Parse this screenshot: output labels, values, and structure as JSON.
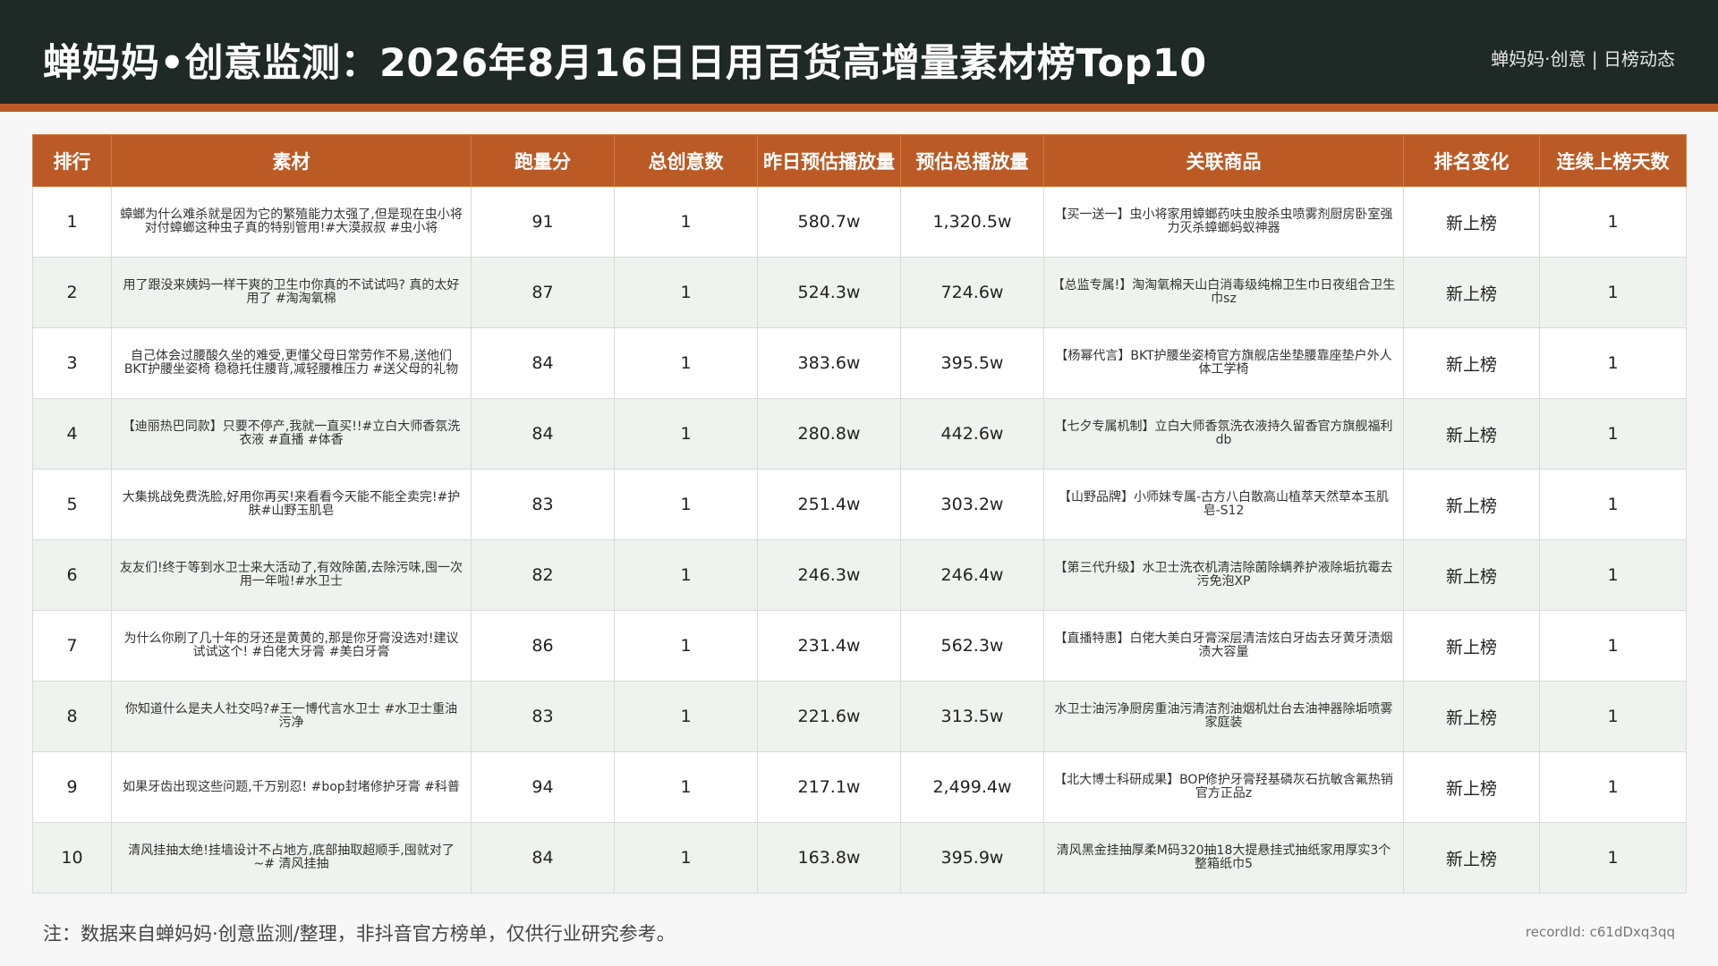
{
  "header": {
    "title": "蝉妈妈•创意监测：2026年8月16日日用百货高增量素材榜Top10",
    "brand_tag": "蝉妈妈·创意 | 日榜动态"
  },
  "colors": {
    "header_bg": "#1f2926",
    "accent": "#bb5a25",
    "alt_row": "#eef3ef"
  },
  "table": {
    "columns": [
      "排行",
      "素材",
      "跑量分",
      "总创意数",
      "昨日预估播放量",
      "预估总播放量",
      "关联商品",
      "排名变化",
      "连续上榜天数"
    ],
    "rows": [
      {
        "rank": "1",
        "material": "蟑螂为什么难杀就是因为它的繁殖能力太强了,但是现在虫小将对付蟑螂这种虫子真的特别管用!#大漠叔叔 #虫小将",
        "score": "91",
        "creatives": "1",
        "yesterday_plays": "580.7w",
        "total_plays": "1,320.5w",
        "product": "【买一送一】虫小将家用蟑螂药呋虫胺杀虫喷雾剂厨房卧室强力灭杀蟑螂蚂蚁神器",
        "rank_change": "新上榜",
        "days": "1"
      },
      {
        "rank": "2",
        "material": "用了跟没来姨妈一样干爽的卫生巾你真的不试试吗? 真的太好用了 #淘淘氧棉",
        "score": "87",
        "creatives": "1",
        "yesterday_plays": "524.3w",
        "total_plays": "724.6w",
        "product": "【总监专属!】淘淘氧棉天山白消毒级纯棉卫生巾日夜组合卫生巾sz",
        "rank_change": "新上榜",
        "days": "1"
      },
      {
        "rank": "3",
        "material": "自己体会过腰酸久坐的难受,更懂父母日常劳作不易,送他们BKT护腰坐姿椅 稳稳托住腰背,减轻腰椎压力 #送父母的礼物",
        "score": "84",
        "creatives": "1",
        "yesterday_plays": "383.6w",
        "total_plays": "395.5w",
        "product": "【杨幂代言】BKT护腰坐姿椅官方旗舰店坐垫腰靠座垫户外人体工学椅",
        "rank_change": "新上榜",
        "days": "1"
      },
      {
        "rank": "4",
        "material": "【迪丽热巴同款】只要不停产,我就一直买!!#立白大师香氛洗衣液 #直播 #体香",
        "score": "84",
        "creatives": "1",
        "yesterday_plays": "280.8w",
        "total_plays": "442.6w",
        "product": "【七夕专属机制】立白大师香氛洗衣液持久留香官方旗舰福利db",
        "rank_change": "新上榜",
        "days": "1"
      },
      {
        "rank": "5",
        "material": "大集挑战免费洗脸,好用你再买!来看看今天能不能全卖完!#护肤#山野玉肌皂",
        "score": "83",
        "creatives": "1",
        "yesterday_plays": "251.4w",
        "total_plays": "303.2w",
        "product": "【山野品牌】小师妹专属-古方八白散高山植萃天然草本玉肌皂-S12",
        "rank_change": "新上榜",
        "days": "1"
      },
      {
        "rank": "6",
        "material": "友友们!终于等到水卫士来大活动了,有效除菌,去除污味,囤一次用一年啦!#水卫士",
        "score": "82",
        "creatives": "1",
        "yesterday_plays": "246.3w",
        "total_plays": "246.4w",
        "product": "【第三代升级】水卫士洗衣机清洁除菌除螨养护液除垢抗霉去污免泡XP",
        "rank_change": "新上榜",
        "days": "1"
      },
      {
        "rank": "7",
        "material": "为什么你刷了几十年的牙还是黄黄的,那是你牙膏没选对!建议试试这个! #白佬大牙膏 #美白牙膏",
        "score": "86",
        "creatives": "1",
        "yesterday_plays": "231.4w",
        "total_plays": "562.3w",
        "product": "【直播特惠】白佬大美白牙膏深层清洁炫白牙齿去牙黄牙渍烟渍大容量",
        "rank_change": "新上榜",
        "days": "1"
      },
      {
        "rank": "8",
        "material": "你知道什么是夫人社交吗?#王一博代言水卫士 #水卫士重油污净",
        "score": "83",
        "creatives": "1",
        "yesterday_plays": "221.6w",
        "total_plays": "313.5w",
        "product": "水卫士油污净厨房重油污清洁剂油烟机灶台去油神器除垢喷雾家庭装",
        "rank_change": "新上榜",
        "days": "1"
      },
      {
        "rank": "9",
        "material": "如果牙齿出现这些问题,千万别忍! #bop封堵修护牙膏 #科普",
        "score": "94",
        "creatives": "1",
        "yesterday_plays": "217.1w",
        "total_plays": "2,499.4w",
        "product": "【北大博士科研成果】BOP修护牙膏羟基磷灰石抗敏含氟热销官方正品z",
        "rank_change": "新上榜",
        "days": "1"
      },
      {
        "rank": "10",
        "material": "清风挂抽太绝!挂墙设计不占地方,底部抽取超顺手,囤就对了~# 清风挂抽",
        "score": "84",
        "creatives": "1",
        "yesterday_plays": "163.8w",
        "total_plays": "395.9w",
        "product": "清风黑金挂抽厚柔M码320抽18大提悬挂式抽纸家用厚实3个整箱纸巾5",
        "rank_change": "新上榜",
        "days": "1"
      }
    ]
  },
  "footer": {
    "note": "注：数据来自蝉妈妈·创意监测/整理，非抖音官方榜单，仅供行业研究参考。",
    "record_id": "recordId: c61dDxq3qq"
  }
}
